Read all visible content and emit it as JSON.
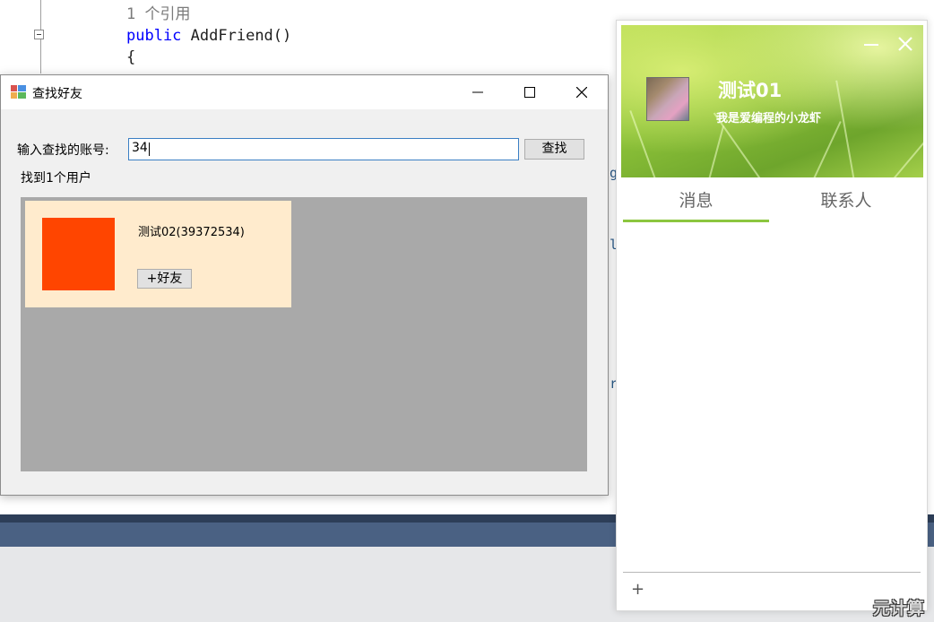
{
  "editor": {
    "reference_hint": "1 个引用",
    "signature_keyword": "public",
    "signature_name": "AddFriend()",
    "brace": "{",
    "fragments": [
      "g",
      "l",
      "r"
    ]
  },
  "find_dialog": {
    "title": "查找好友",
    "account_label": "输入查找的账号:",
    "account_value": "34",
    "search_button": "查找",
    "result_count": "找到1个用户",
    "results": [
      {
        "name": "测试02(39372534)",
        "avatar_color": "#ff4500",
        "add_button": "+好友"
      }
    ]
  },
  "chat_window": {
    "profile": {
      "name": "测试01",
      "signature": "我是爱编程的小龙虾"
    },
    "tabs": [
      {
        "label": "消息",
        "active": true
      },
      {
        "label": "联系人",
        "active": false
      }
    ],
    "accent_color": "#8cc63f",
    "add_label": "+"
  },
  "watermark": "元计算"
}
